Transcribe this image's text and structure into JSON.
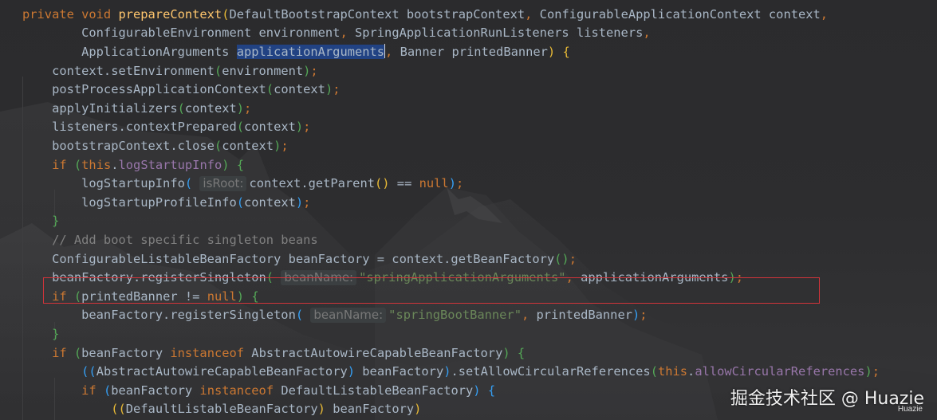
{
  "editor": {
    "lines": [
      [
        {
          "t": "private void ",
          "c": "kw"
        },
        {
          "t": "prepareContext",
          "c": "fn"
        },
        {
          "t": "(",
          "c": "par1"
        },
        {
          "t": "DefaultBootstrapContext bootstrapContext",
          "c": ""
        },
        {
          "t": ", ",
          "c": "pun"
        },
        {
          "t": "ConfigurableApplicationContext context",
          "c": ""
        },
        {
          "t": ",",
          "c": "pun"
        }
      ],
      [
        {
          "t": "        ConfigurableEnvironment environment",
          "c": ""
        },
        {
          "t": ", ",
          "c": "pun"
        },
        {
          "t": "SpringApplicationRunListeners listeners",
          "c": ""
        },
        {
          "t": ",",
          "c": "pun"
        }
      ],
      [
        {
          "t": "        ApplicationArguments ",
          "c": ""
        },
        {
          "t": "applicationArguments",
          "c": "sel"
        },
        {
          "t": "",
          "c": "caret"
        },
        {
          "t": ", ",
          "c": "pun"
        },
        {
          "t": "Banner printedBanner",
          "c": ""
        },
        {
          "t": ") ",
          "c": "par1"
        },
        {
          "t": "{",
          "c": "par1"
        }
      ],
      [
        {
          "t": "    context.setEnvironment",
          "c": ""
        },
        {
          "t": "(",
          "c": "par2"
        },
        {
          "t": "environment",
          "c": ""
        },
        {
          "t": ")",
          "c": "par2"
        },
        {
          "t": ";",
          "c": "pun"
        }
      ],
      [
        {
          "t": "    postProcessApplicationContext",
          "c": ""
        },
        {
          "t": "(",
          "c": "par2"
        },
        {
          "t": "context",
          "c": ""
        },
        {
          "t": ")",
          "c": "par2"
        },
        {
          "t": ";",
          "c": "pun"
        }
      ],
      [
        {
          "t": "    applyInitializers",
          "c": ""
        },
        {
          "t": "(",
          "c": "par2"
        },
        {
          "t": "context",
          "c": ""
        },
        {
          "t": ")",
          "c": "par2"
        },
        {
          "t": ";",
          "c": "pun"
        }
      ],
      [
        {
          "t": "    listeners.contextPrepared",
          "c": ""
        },
        {
          "t": "(",
          "c": "par2"
        },
        {
          "t": "context",
          "c": ""
        },
        {
          "t": ")",
          "c": "par2"
        },
        {
          "t": ";",
          "c": "pun"
        }
      ],
      [
        {
          "t": "    bootstrapContext.close",
          "c": ""
        },
        {
          "t": "(",
          "c": "par2"
        },
        {
          "t": "context",
          "c": ""
        },
        {
          "t": ")",
          "c": "par2"
        },
        {
          "t": ";",
          "c": "pun"
        }
      ],
      [
        {
          "t": "    if ",
          "c": "kw"
        },
        {
          "t": "(",
          "c": "par2"
        },
        {
          "t": "this",
          "c": "kw"
        },
        {
          "t": ".",
          "c": ""
        },
        {
          "t": "logStartupInfo",
          "c": "fld"
        },
        {
          "t": ") ",
          "c": "par2"
        },
        {
          "t": "{",
          "c": "par2"
        }
      ],
      [
        {
          "t": "        logStartupInfo",
          "c": ""
        },
        {
          "t": "(",
          "c": "par3"
        },
        {
          "t": " ",
          "c": ""
        },
        {
          "t": "isRoot:",
          "c": "hint"
        },
        {
          "t": "context.getParent",
          "c": ""
        },
        {
          "t": "()",
          "c": "par1"
        },
        {
          "t": " == ",
          "c": ""
        },
        {
          "t": "null",
          "c": "null"
        },
        {
          "t": ")",
          "c": "par3"
        },
        {
          "t": ";",
          "c": "pun"
        }
      ],
      [
        {
          "t": "        logStartupProfileInfo",
          "c": ""
        },
        {
          "t": "(",
          "c": "par3"
        },
        {
          "t": "context",
          "c": ""
        },
        {
          "t": ")",
          "c": "par3"
        },
        {
          "t": ";",
          "c": "pun"
        }
      ],
      [
        {
          "t": "    }",
          "c": "par2"
        }
      ],
      [
        {
          "t": "    // Add boot specific singleton beans",
          "c": "cmt"
        }
      ],
      [
        {
          "t": "    ConfigurableListableBeanFactory beanFactory = context.getBeanFactory",
          "c": ""
        },
        {
          "t": "()",
          "c": "par2"
        },
        {
          "t": ";",
          "c": "pun"
        }
      ],
      [
        {
          "t": "    beanFactory.registerSingleton",
          "c": ""
        },
        {
          "t": "(",
          "c": "par2"
        },
        {
          "t": " ",
          "c": ""
        },
        {
          "t": "beanName:",
          "c": "hint"
        },
        {
          "t": "\"springApplicationArguments\"",
          "c": "str"
        },
        {
          "t": ", ",
          "c": "pun"
        },
        {
          "t": "applicationArguments",
          "c": ""
        },
        {
          "t": ")",
          "c": "par2"
        },
        {
          "t": ";",
          "c": "pun"
        }
      ],
      [
        {
          "t": "    if ",
          "c": "kw"
        },
        {
          "t": "(",
          "c": "par2"
        },
        {
          "t": "printedBanner != ",
          "c": ""
        },
        {
          "t": "null",
          "c": "null"
        },
        {
          "t": ") ",
          "c": "par2"
        },
        {
          "t": "{",
          "c": "par2"
        }
      ],
      [
        {
          "t": "        beanFactory.registerSingleton",
          "c": ""
        },
        {
          "t": "(",
          "c": "par3"
        },
        {
          "t": " ",
          "c": ""
        },
        {
          "t": "beanName:",
          "c": "hint"
        },
        {
          "t": "\"springBootBanner\"",
          "c": "str"
        },
        {
          "t": ", ",
          "c": "pun"
        },
        {
          "t": "printedBanner",
          "c": ""
        },
        {
          "t": ")",
          "c": "par3"
        },
        {
          "t": ";",
          "c": "pun"
        }
      ],
      [
        {
          "t": "    }",
          "c": "par2"
        }
      ],
      [
        {
          "t": "    if ",
          "c": "kw"
        },
        {
          "t": "(",
          "c": "par2"
        },
        {
          "t": "beanFactory ",
          "c": ""
        },
        {
          "t": "instanceof ",
          "c": "kw"
        },
        {
          "t": "AbstractAutowireCapableBeanFactory",
          "c": ""
        },
        {
          "t": ") ",
          "c": "par2"
        },
        {
          "t": "{",
          "c": "par2"
        }
      ],
      [
        {
          "t": "        ",
          "c": ""
        },
        {
          "t": "((",
          "c": "par3"
        },
        {
          "t": "AbstractAutowireCapableBeanFactory",
          "c": ""
        },
        {
          "t": ") ",
          "c": "par3"
        },
        {
          "t": "beanFactory",
          "c": ""
        },
        {
          "t": ")",
          "c": "par3"
        },
        {
          "t": ".setAllowCircularReferences",
          "c": ""
        },
        {
          "t": "(",
          "c": "par2"
        },
        {
          "t": "this",
          "c": "kw"
        },
        {
          "t": ".",
          "c": ""
        },
        {
          "t": "allowCircularReferences",
          "c": "fld"
        },
        {
          "t": ")",
          "c": "par2"
        },
        {
          "t": ";",
          "c": "pun"
        }
      ],
      [
        {
          "t": "        if ",
          "c": "kw"
        },
        {
          "t": "(",
          "c": "par3"
        },
        {
          "t": "beanFactory ",
          "c": ""
        },
        {
          "t": "instanceof ",
          "c": "kw"
        },
        {
          "t": "DefaultListableBeanFactory",
          "c": ""
        },
        {
          "t": ") ",
          "c": "par3"
        },
        {
          "t": "{",
          "c": "par3"
        }
      ],
      [
        {
          "t": "            ",
          "c": ""
        },
        {
          "t": "((",
          "c": "par1"
        },
        {
          "t": "DefaultListableBeanFactory",
          "c": ""
        },
        {
          "t": ") ",
          "c": "par1"
        },
        {
          "t": "beanFactory",
          "c": ""
        },
        {
          "t": ")",
          "c": "par1"
        }
      ]
    ]
  },
  "watermark": {
    "text": "掘金技术社区 @ Huazie",
    "sub": "Huazie"
  }
}
